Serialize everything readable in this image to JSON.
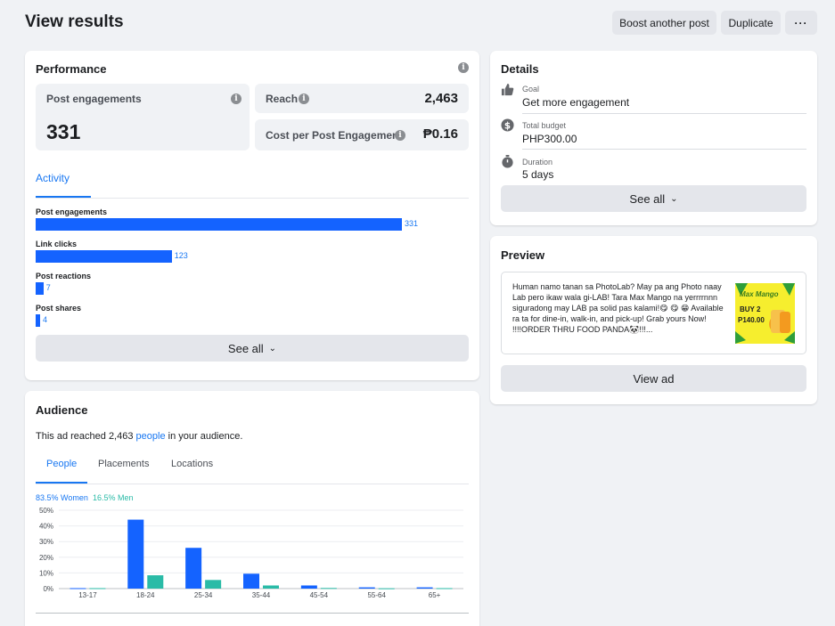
{
  "header": {
    "title": "View results",
    "boost_label": "Boost another post",
    "duplicate_label": "Duplicate",
    "more_label": "···"
  },
  "performance": {
    "title": "Performance",
    "engagements_label": "Post engagements",
    "engagements_value": "331",
    "reach_label": "Reach",
    "reach_value": "2,463",
    "cost_label": "Cost per Post Engagement",
    "cost_value": "₱0.16",
    "tab_label": "Activity",
    "activity": [
      {
        "label": "Post engagements",
        "value": 331
      },
      {
        "label": "Link clicks",
        "value": 123
      },
      {
        "label": "Post reactions",
        "value": 7
      },
      {
        "label": "Post shares",
        "value": 4
      }
    ],
    "see_all_label": "See all"
  },
  "details": {
    "title": "Details",
    "goal_label": "Goal",
    "goal_value": "Get more engagement",
    "budget_label": "Total budget",
    "budget_value": "PHP300.00",
    "duration_label": "Duration",
    "duration_value": "5 days",
    "see_all_label": "See all"
  },
  "preview": {
    "title": "Preview",
    "ad_text": "Human namo tanan sa PhotoLab? May pa ang Photo naay Lab pero ikaw wala gi-LAB! Tara Max Mango na yerrrrnnn siguradong may LAB pa solid pas kalami!😋 😋 😁 Available ra ta for dine-in, walk-in, and pick-up! Grab yours Now! !!!!ORDER THRU FOOD PANDA🐼!!!...",
    "thumb_brand": "Max Mango",
    "thumb_offer": "BUY 2",
    "thumb_price": "P140.00",
    "view_ad_label": "View ad"
  },
  "audience": {
    "title": "Audience",
    "reach_prefix": "This ad reached ",
    "reach_count": "2,463",
    "reach_link": "people",
    "reach_suffix": " in your audience.",
    "tabs": [
      "People",
      "Placements",
      "Locations"
    ],
    "women_legend": "83.5% Women",
    "men_legend": "16.5% Men"
  },
  "colors": {
    "accent": "#1877f2",
    "bar_blue": "#1463ff",
    "men_teal": "#2abba7"
  },
  "chart_data": {
    "type": "bar",
    "categories": [
      "13-17",
      "18-24",
      "25-34",
      "35-44",
      "45-54",
      "55-64",
      "65+"
    ],
    "series": [
      {
        "name": "Women",
        "values": [
          0.3,
          44,
          26,
          9.5,
          2,
          0.8,
          0.8
        ]
      },
      {
        "name": "Men",
        "values": [
          0.3,
          8.5,
          5.5,
          2,
          0.4,
          0.2,
          0.3
        ]
      }
    ],
    "yticks": [
      "0%",
      "10%",
      "20%",
      "30%",
      "40%",
      "50%"
    ],
    "ylim": [
      0,
      50
    ],
    "grid": true
  }
}
